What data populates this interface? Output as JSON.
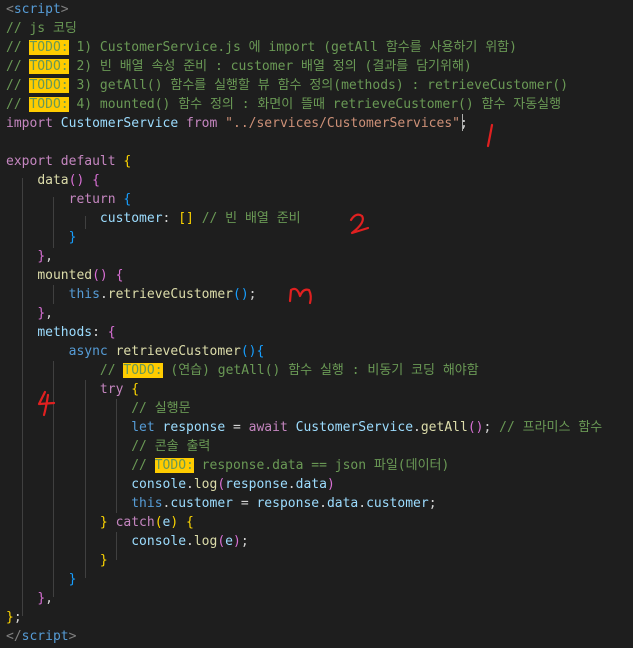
{
  "colors": {
    "background": "#1e1e1e",
    "comment": "#6a9955",
    "keyword": "#c586c0",
    "todo_highlight": "#ffcc00",
    "annotation": "#e02020"
  },
  "lines": [
    [
      {
        "t": "<",
        "c": "tag"
      },
      {
        "t": "script",
        "c": "tagname"
      },
      {
        "t": ">",
        "c": "tag"
      }
    ],
    [
      {
        "t": "// js 코딩",
        "c": "comment"
      }
    ],
    [
      {
        "t": "// ",
        "c": "comment"
      },
      {
        "t": "TODO:",
        "c": "todo"
      },
      {
        "t": " 1) CustomerService.js 에 import (getAll 함수를 사용하기 위함)",
        "c": "comment"
      }
    ],
    [
      {
        "t": "// ",
        "c": "comment"
      },
      {
        "t": "TODO:",
        "c": "todo"
      },
      {
        "t": " 2) 빈 배열 속성 준비 : customer 배열 정의 (결과를 담기위해)",
        "c": "comment"
      }
    ],
    [
      {
        "t": "// ",
        "c": "comment"
      },
      {
        "t": "TODO:",
        "c": "todo"
      },
      {
        "t": " 3) getAll() 함수를 실행할 뷰 함수 정의(methods) : retrieveCustomer()",
        "c": "comment"
      }
    ],
    [
      {
        "t": "// ",
        "c": "comment"
      },
      {
        "t": "TODO:",
        "c": "todo"
      },
      {
        "t": " 4) mounted() 함수 정의 : 화면이 뜰때 retrieveCustomer() 함수 자동실행",
        "c": "comment"
      }
    ],
    [
      {
        "t": "import",
        "c": "kw"
      },
      {
        "t": " ",
        "c": "plain"
      },
      {
        "t": "CustomerService",
        "c": "var"
      },
      {
        "t": " ",
        "c": "plain"
      },
      {
        "t": "from",
        "c": "kw"
      },
      {
        "t": " ",
        "c": "plain"
      },
      {
        "t": "\"../services/CustomerServices\"",
        "c": "str"
      },
      {
        "t": ";",
        "c": "plain"
      }
    ],
    [],
    [
      {
        "t": "export",
        "c": "kw"
      },
      {
        "t": " ",
        "c": "plain"
      },
      {
        "t": "default",
        "c": "kw"
      },
      {
        "t": " ",
        "c": "plain"
      },
      {
        "t": "{",
        "c": "br1"
      }
    ],
    [
      {
        "t": "    ",
        "c": "plain"
      },
      {
        "t": "data",
        "c": "fn"
      },
      {
        "t": "()",
        "c": "br2"
      },
      {
        "t": " ",
        "c": "plain"
      },
      {
        "t": "{",
        "c": "br2"
      }
    ],
    [
      {
        "t": "        ",
        "c": "plain"
      },
      {
        "t": "return",
        "c": "kw"
      },
      {
        "t": " ",
        "c": "plain"
      },
      {
        "t": "{",
        "c": "br3"
      }
    ],
    [
      {
        "t": "            ",
        "c": "plain"
      },
      {
        "t": "customer",
        "c": "var"
      },
      {
        "t": ": ",
        "c": "plain"
      },
      {
        "t": "[]",
        "c": "br1"
      },
      {
        "t": " ",
        "c": "plain"
      },
      {
        "t": "// 빈 배열 준비",
        "c": "comment"
      }
    ],
    [
      {
        "t": "        ",
        "c": "plain"
      },
      {
        "t": "}",
        "c": "br3"
      }
    ],
    [
      {
        "t": "    ",
        "c": "plain"
      },
      {
        "t": "}",
        "c": "br2"
      },
      {
        "t": ",",
        "c": "plain"
      }
    ],
    [
      {
        "t": "    ",
        "c": "plain"
      },
      {
        "t": "mounted",
        "c": "fn"
      },
      {
        "t": "()",
        "c": "br2"
      },
      {
        "t": " ",
        "c": "plain"
      },
      {
        "t": "{",
        "c": "br2"
      }
    ],
    [
      {
        "t": "        ",
        "c": "plain"
      },
      {
        "t": "this",
        "c": "this"
      },
      {
        "t": ".",
        "c": "plain"
      },
      {
        "t": "retrieveCustomer",
        "c": "fn"
      },
      {
        "t": "()",
        "c": "br3"
      },
      {
        "t": ";",
        "c": "plain"
      }
    ],
    [
      {
        "t": "    ",
        "c": "plain"
      },
      {
        "t": "}",
        "c": "br2"
      },
      {
        "t": ",",
        "c": "plain"
      }
    ],
    [
      {
        "t": "    ",
        "c": "plain"
      },
      {
        "t": "methods",
        "c": "var"
      },
      {
        "t": ": ",
        "c": "plain"
      },
      {
        "t": "{",
        "c": "br2"
      }
    ],
    [
      {
        "t": "        ",
        "c": "plain"
      },
      {
        "t": "async",
        "c": "this"
      },
      {
        "t": " ",
        "c": "plain"
      },
      {
        "t": "retrieveCustomer",
        "c": "fn"
      },
      {
        "t": "()",
        "c": "br3"
      },
      {
        "t": "{",
        "c": "br3"
      }
    ],
    [
      {
        "t": "            ",
        "c": "plain"
      },
      {
        "t": "// ",
        "c": "comment"
      },
      {
        "t": "TODO:",
        "c": "todo"
      },
      {
        "t": " (연습) getAll() 함수 실행 : 비동기 코딩 해야함",
        "c": "comment"
      }
    ],
    [
      {
        "t": "            ",
        "c": "plain"
      },
      {
        "t": "try",
        "c": "kw"
      },
      {
        "t": " ",
        "c": "plain"
      },
      {
        "t": "{",
        "c": "br1"
      }
    ],
    [
      {
        "t": "                ",
        "c": "plain"
      },
      {
        "t": "// 실행문",
        "c": "comment"
      }
    ],
    [
      {
        "t": "                ",
        "c": "plain"
      },
      {
        "t": "let",
        "c": "this"
      },
      {
        "t": " ",
        "c": "plain"
      },
      {
        "t": "response",
        "c": "var"
      },
      {
        "t": " = ",
        "c": "plain"
      },
      {
        "t": "await",
        "c": "kw"
      },
      {
        "t": " ",
        "c": "plain"
      },
      {
        "t": "CustomerService",
        "c": "var"
      },
      {
        "t": ".",
        "c": "plain"
      },
      {
        "t": "getAll",
        "c": "fn"
      },
      {
        "t": "()",
        "c": "br2"
      },
      {
        "t": "; ",
        "c": "plain"
      },
      {
        "t": "// 프라미스 함수",
        "c": "comment"
      }
    ],
    [
      {
        "t": "                ",
        "c": "plain"
      },
      {
        "t": "// 콘솔 출력",
        "c": "comment"
      }
    ],
    [
      {
        "t": "                ",
        "c": "plain"
      },
      {
        "t": "// ",
        "c": "comment"
      },
      {
        "t": "TODO:",
        "c": "todo"
      },
      {
        "t": " response.data == json 파일(데이터)",
        "c": "comment"
      }
    ],
    [
      {
        "t": "                ",
        "c": "plain"
      },
      {
        "t": "console",
        "c": "var"
      },
      {
        "t": ".",
        "c": "plain"
      },
      {
        "t": "log",
        "c": "fn"
      },
      {
        "t": "(",
        "c": "br2"
      },
      {
        "t": "response",
        "c": "var"
      },
      {
        "t": ".",
        "c": "plain"
      },
      {
        "t": "data",
        "c": "var"
      },
      {
        "t": ")",
        "c": "br2"
      }
    ],
    [
      {
        "t": "                ",
        "c": "plain"
      },
      {
        "t": "this",
        "c": "this"
      },
      {
        "t": ".",
        "c": "plain"
      },
      {
        "t": "customer",
        "c": "var"
      },
      {
        "t": " = ",
        "c": "plain"
      },
      {
        "t": "response",
        "c": "var"
      },
      {
        "t": ".",
        "c": "plain"
      },
      {
        "t": "data",
        "c": "var"
      },
      {
        "t": ".",
        "c": "plain"
      },
      {
        "t": "customer",
        "c": "var"
      },
      {
        "t": ";",
        "c": "plain"
      }
    ],
    [
      {
        "t": "            ",
        "c": "plain"
      },
      {
        "t": "}",
        "c": "br1"
      },
      {
        "t": " ",
        "c": "plain"
      },
      {
        "t": "catch",
        "c": "kw"
      },
      {
        "t": "(",
        "c": "br1"
      },
      {
        "t": "e",
        "c": "var"
      },
      {
        "t": ")",
        "c": "br1"
      },
      {
        "t": " ",
        "c": "plain"
      },
      {
        "t": "{",
        "c": "br1"
      }
    ],
    [
      {
        "t": "                ",
        "c": "plain"
      },
      {
        "t": "console",
        "c": "var"
      },
      {
        "t": ".",
        "c": "plain"
      },
      {
        "t": "log",
        "c": "fn"
      },
      {
        "t": "(",
        "c": "br2"
      },
      {
        "t": "e",
        "c": "var"
      },
      {
        "t": ")",
        "c": "br2"
      },
      {
        "t": ";",
        "c": "plain"
      }
    ],
    [
      {
        "t": "            ",
        "c": "plain"
      },
      {
        "t": "}",
        "c": "br1"
      }
    ],
    [
      {
        "t": "        ",
        "c": "plain"
      },
      {
        "t": "}",
        "c": "br3"
      }
    ],
    [
      {
        "t": "    ",
        "c": "plain"
      },
      {
        "t": "}",
        "c": "br2"
      },
      {
        "t": ",",
        "c": "plain"
      }
    ],
    [
      {
        "t": "}",
        "c": "br1"
      },
      {
        "t": ";",
        "c": "plain"
      }
    ],
    [
      {
        "t": "</",
        "c": "tag"
      },
      {
        "t": "script",
        "c": "tagname"
      },
      {
        "t": ">",
        "c": "tag"
      }
    ]
  ],
  "annotations": [
    {
      "text": "1"
    },
    {
      "text": "2"
    },
    {
      "text": "3"
    },
    {
      "text": "4"
    }
  ]
}
